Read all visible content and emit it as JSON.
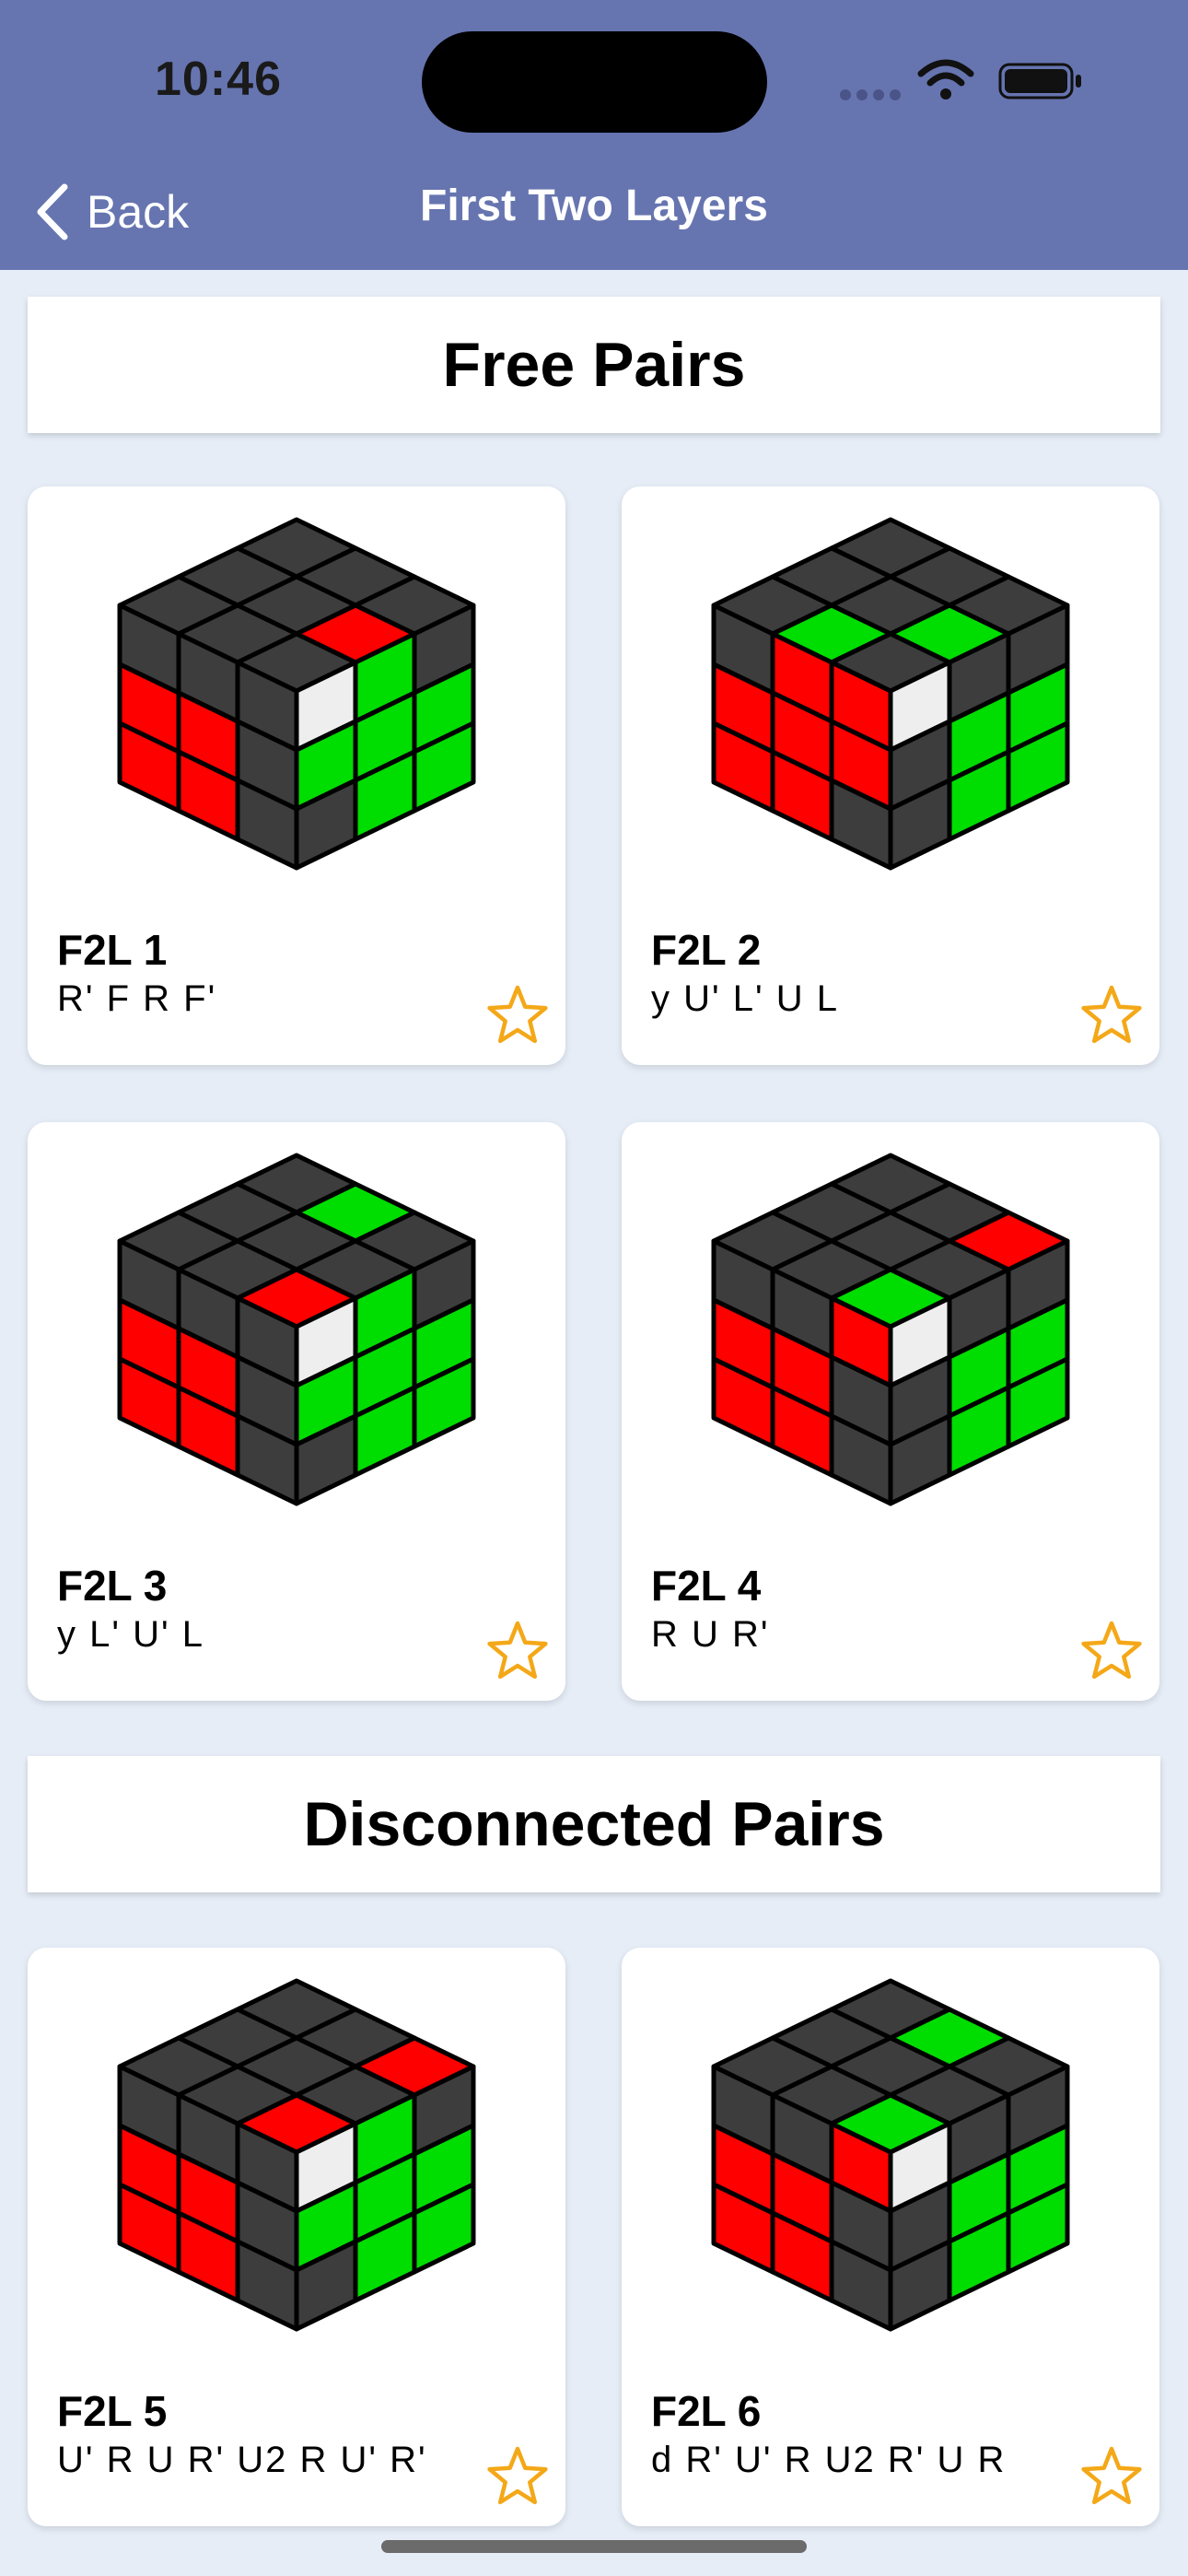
{
  "status_bar": {
    "time": "10:46"
  },
  "nav": {
    "back_label": "Back",
    "title": "First Two Layers"
  },
  "colors": {
    "nav_bg": "#6675b0",
    "sticker_dark": "#3d3d3d",
    "sticker_red": "#ff0000",
    "sticker_green": "#00dd00",
    "sticker_white": "#eeeeee",
    "star": "#f4a818"
  },
  "sections": [
    {
      "title": "Free Pairs",
      "cases": [
        {
          "name": "F2L 1",
          "alg": "R' F R F'",
          "top": [
            "D",
            "D",
            "D",
            "D",
            "D",
            "R",
            "D",
            "D",
            "D"
          ],
          "left": [
            "D",
            "D",
            "D",
            "R",
            "R",
            "D",
            "R",
            "R",
            "D"
          ],
          "right": [
            "W",
            "G",
            "D",
            "G",
            "G",
            "G",
            "D",
            "G",
            "G"
          ]
        },
        {
          "name": "F2L 2",
          "alg": "y U' L' U L",
          "top": [
            "D",
            "D",
            "D",
            "D",
            "D",
            "G",
            "D",
            "G",
            "D"
          ],
          "left": [
            "D",
            "R",
            "R",
            "R",
            "R",
            "R",
            "R",
            "R",
            "D"
          ],
          "right": [
            "W",
            "D",
            "D",
            "D",
            "G",
            "G",
            "D",
            "G",
            "G"
          ]
        },
        {
          "name": "F2L 3",
          "alg": "y L' U' L",
          "top": [
            "D",
            "G",
            "D",
            "D",
            "D",
            "D",
            "D",
            "D",
            "R"
          ],
          "left": [
            "D",
            "D",
            "D",
            "R",
            "R",
            "D",
            "R",
            "R",
            "D"
          ],
          "right": [
            "W",
            "G",
            "D",
            "G",
            "G",
            "G",
            "D",
            "G",
            "G"
          ]
        },
        {
          "name": "F2L 4",
          "alg": "R U R'",
          "top": [
            "D",
            "D",
            "R",
            "D",
            "D",
            "D",
            "D",
            "D",
            "G"
          ],
          "left": [
            "D",
            "D",
            "R",
            "R",
            "R",
            "D",
            "R",
            "R",
            "D"
          ],
          "right": [
            "W",
            "D",
            "D",
            "D",
            "G",
            "G",
            "D",
            "G",
            "G"
          ]
        }
      ]
    },
    {
      "title": "Disconnected Pairs",
      "cases": [
        {
          "name": "F2L 5",
          "alg": "U' R U R' U2 R U' R'",
          "top": [
            "D",
            "D",
            "R",
            "D",
            "D",
            "D",
            "D",
            "D",
            "R"
          ],
          "left": [
            "D",
            "D",
            "D",
            "R",
            "R",
            "D",
            "R",
            "R",
            "D"
          ],
          "right": [
            "W",
            "G",
            "D",
            "G",
            "G",
            "G",
            "D",
            "G",
            "G"
          ]
        },
        {
          "name": "F2L 6",
          "alg": "d R' U' R U2 R' U R",
          "top": [
            "D",
            "G",
            "D",
            "D",
            "D",
            "D",
            "D",
            "D",
            "G"
          ],
          "left": [
            "D",
            "D",
            "R",
            "R",
            "R",
            "D",
            "R",
            "R",
            "D"
          ],
          "right": [
            "W",
            "D",
            "D",
            "D",
            "G",
            "G",
            "D",
            "G",
            "G"
          ]
        }
      ]
    }
  ]
}
